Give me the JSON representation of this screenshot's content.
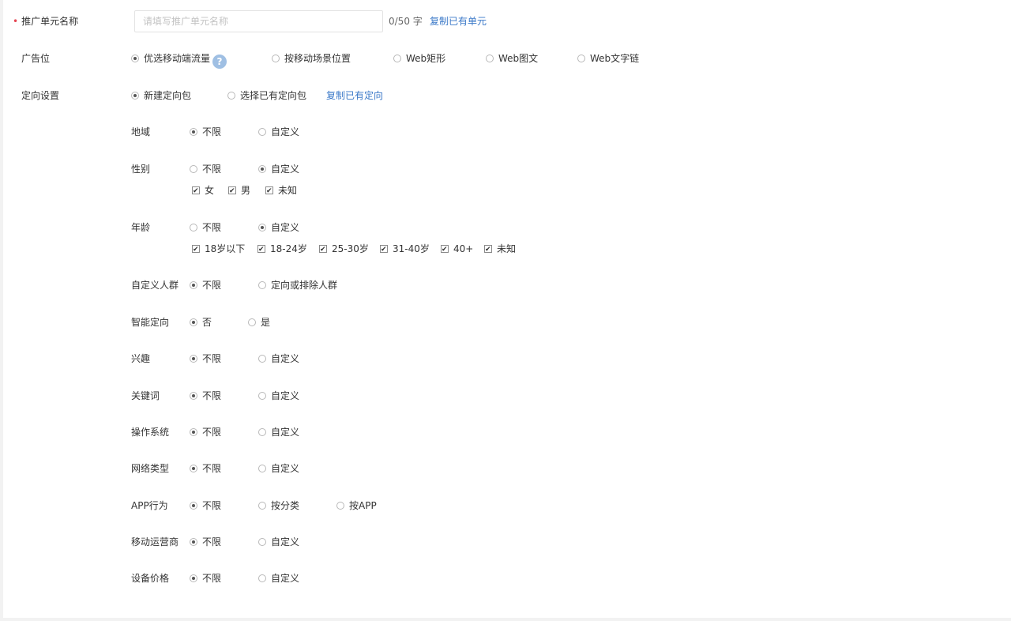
{
  "unit_name": {
    "required_mark": "•",
    "label": "推广单元名称",
    "placeholder": "请填写推广单元名称",
    "value": "",
    "counter": "0/50 字",
    "copy_link": "复制已有单元"
  },
  "ad_position": {
    "label": "广告位",
    "options": [
      "优选移动端流量",
      "按移动场景位置",
      "Web矩形",
      "Web图文",
      "Web文字链"
    ],
    "selected": "优选移动端流量",
    "help_icon": "question-circle-icon",
    "help_text": "?"
  },
  "targeting": {
    "label": "定向设置",
    "options": [
      "新建定向包",
      "选择已有定向包"
    ],
    "selected": "新建定向包",
    "copy_link": "复制已有定向"
  },
  "rows": {
    "region": {
      "label": "地域",
      "options": [
        "不限",
        "自定义"
      ],
      "selected": "不限"
    },
    "gender": {
      "label": "性别",
      "options": [
        "不限",
        "自定义"
      ],
      "selected": "自定义",
      "checks": [
        "女",
        "男",
        "未知"
      ]
    },
    "age": {
      "label": "年龄",
      "options": [
        "不限",
        "自定义"
      ],
      "selected": "自定义",
      "checks": [
        "18岁以下",
        "18-24岁",
        "25-30岁",
        "31-40岁",
        "40+",
        "未知"
      ]
    },
    "audience": {
      "label": "自定义人群",
      "options": [
        "不限",
        "定向或排除人群"
      ],
      "selected": "不限"
    },
    "smart": {
      "label": "智能定向",
      "options": [
        "否",
        "是"
      ],
      "selected": "否"
    },
    "interest": {
      "label": "兴趣",
      "options": [
        "不限",
        "自定义"
      ],
      "selected": "不限"
    },
    "keyword": {
      "label": "关键词",
      "options": [
        "不限",
        "自定义"
      ],
      "selected": "不限"
    },
    "os": {
      "label": "操作系统",
      "options": [
        "不限",
        "自定义"
      ],
      "selected": "不限"
    },
    "network": {
      "label": "网络类型",
      "options": [
        "不限",
        "自定义"
      ],
      "selected": "不限"
    },
    "app": {
      "label": "APP行为",
      "options": [
        "不限",
        "按分类",
        "按APP"
      ],
      "selected": "不限"
    },
    "carrier": {
      "label": "移动运营商",
      "options": [
        "不限",
        "自定义"
      ],
      "selected": "不限"
    },
    "price": {
      "label": "设备价格",
      "options": [
        "不限",
        "自定义"
      ],
      "selected": "不限"
    }
  }
}
